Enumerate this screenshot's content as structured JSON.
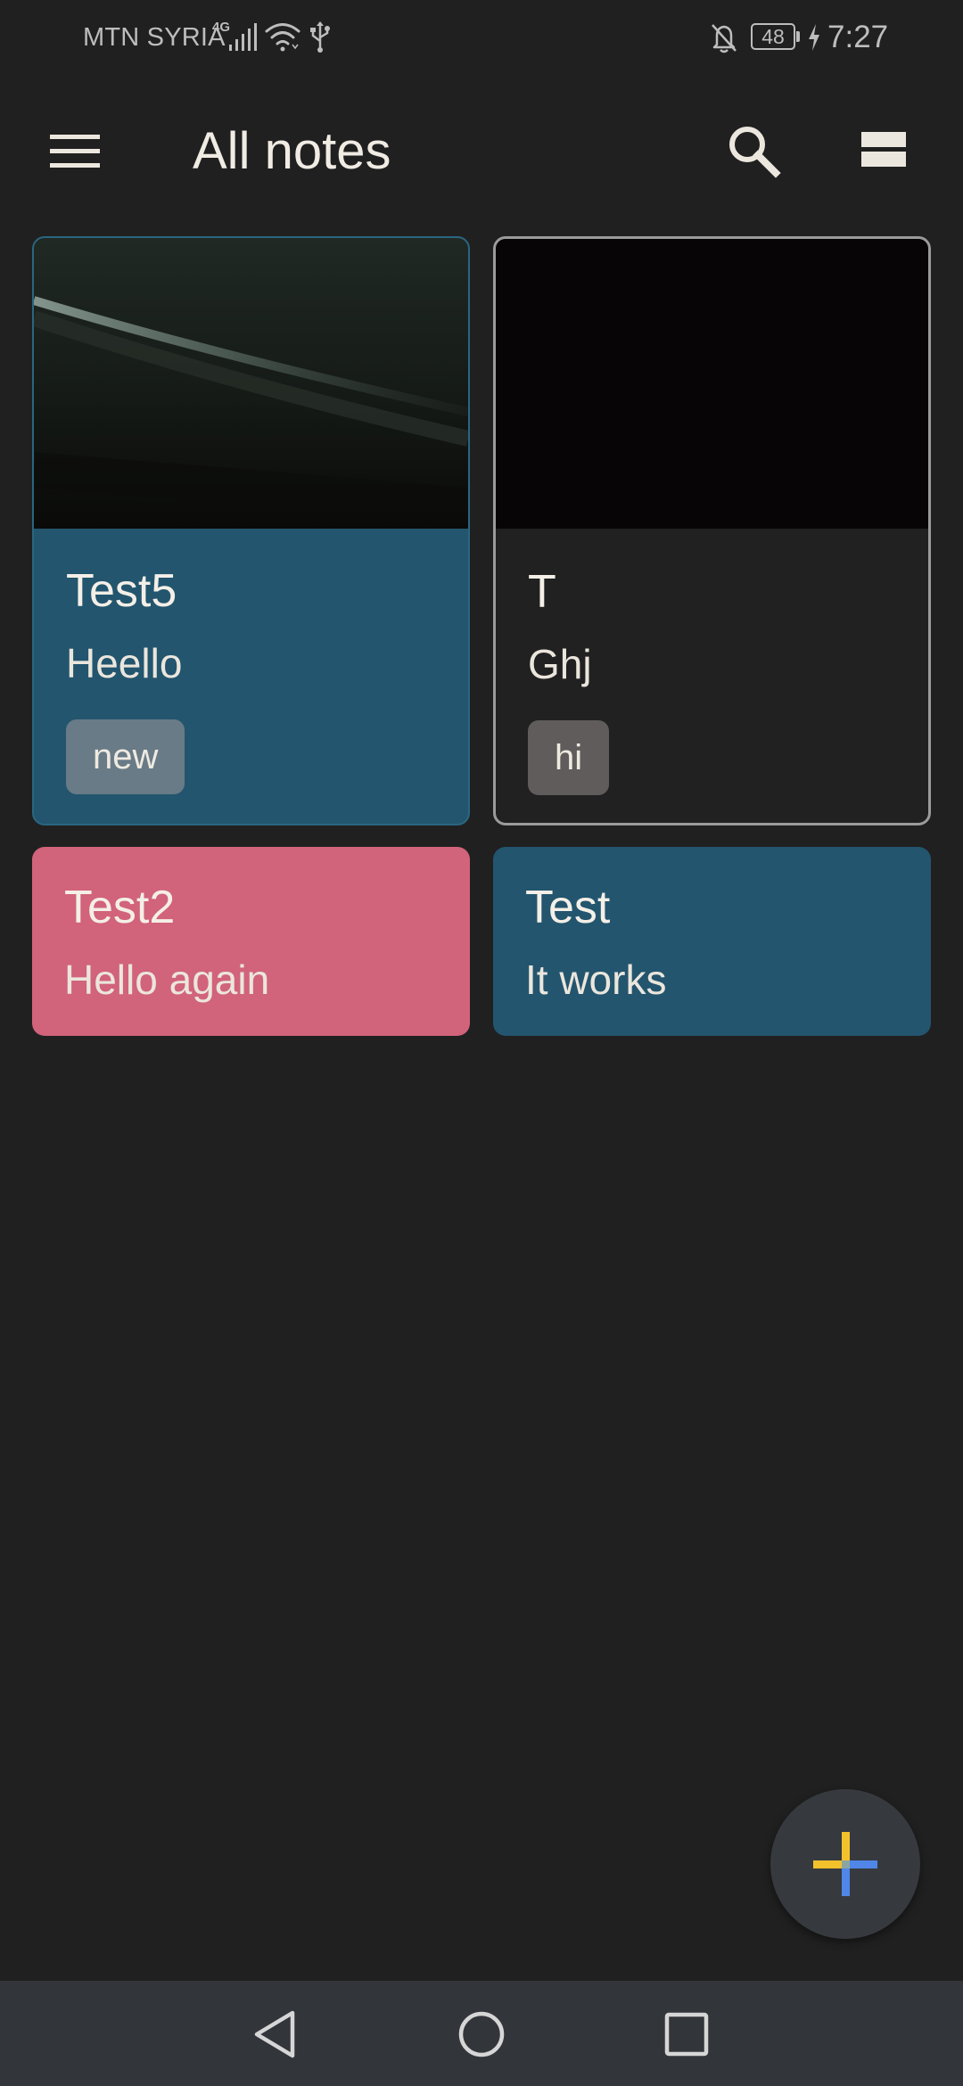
{
  "status_bar": {
    "carrier": "MTN SYRIA",
    "network_type": "4G",
    "battery_level": "48",
    "time": "7:27",
    "icons": [
      "signal-icon",
      "wifi-icon",
      "usb-icon",
      "bell-off-icon",
      "charging-icon"
    ]
  },
  "app_bar": {
    "title": "All notes",
    "icons": [
      "menu-icon",
      "search-icon",
      "layout-toggle-icon"
    ]
  },
  "notes": [
    {
      "title": "Test5",
      "body": "Heello",
      "tag": "new",
      "has_image": true,
      "color": "#23556e"
    },
    {
      "title": "T",
      "body": "Ghj",
      "tag": "hi",
      "has_image": true,
      "color": "#212121"
    },
    {
      "title": "Test2",
      "body": "Hello again",
      "color": "#d1637b"
    },
    {
      "title": "Test",
      "body": "It works",
      "color": "#23556e"
    }
  ],
  "fab": {
    "icon": "plus-icon"
  },
  "navigation_bar": {
    "icons": [
      "back-icon",
      "home-icon",
      "recents-icon"
    ]
  },
  "colors": {
    "background": "#202020",
    "text": "#f0ebe3",
    "nav_bar": "#32353a",
    "fab": "#363a3f"
  }
}
